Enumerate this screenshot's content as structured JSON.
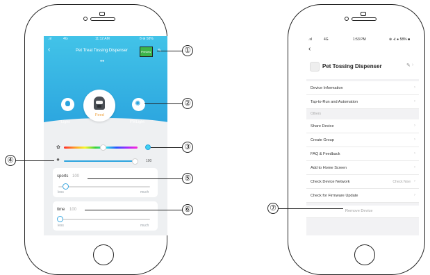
{
  "left_screen": {
    "status": {
      "carrier": ".ııl",
      "network": "4G",
      "time": "11:12 AM",
      "battery": "8 ⊕ 58%"
    },
    "header": {
      "title": "Pet Treat Tossing Dispenser",
      "preview_label": "Preview",
      "indicator": "●●"
    },
    "buttons": {
      "light": "Light",
      "feed": "Feed",
      "fwlight": "FWLight"
    },
    "color_slider": {
      "level": 0.53
    },
    "brightness_slider": {
      "value": "100",
      "level": 0.97
    },
    "sports_card": {
      "title": "sports",
      "value": "100",
      "min_label": "less",
      "max_label": "much",
      "level": 0.08
    },
    "time_card": {
      "title": "time",
      "value": "100",
      "min_label": "less",
      "max_label": "much",
      "level": 0.02
    }
  },
  "right_screen": {
    "status": {
      "carrier": ".ııl",
      "network": "4G",
      "time": "1:53 PM",
      "battery": "⊕ ⊀ ● 58% ■"
    },
    "device_name": "Pet Tossing Dispenser",
    "rows_top": [
      "Device Information",
      "Tap-to-Run and Automation"
    ],
    "section_label": "Others",
    "rows_other": [
      "Share Device",
      "Create Group",
      "FAQ & Feedback",
      "Add to Home Screen"
    ],
    "check_network": {
      "label": "Check Device Network",
      "action": "Check Now"
    },
    "firmware": "Check for Firmware Update",
    "remove": "Remove Device"
  },
  "callouts": [
    "①",
    "②",
    "③",
    "④",
    "⑤",
    "⑥",
    "⑦"
  ],
  "colors": {
    "accent": "#2aa3de",
    "preview_green": "#3cb54a",
    "feed_orange": "#f0a13a"
  }
}
